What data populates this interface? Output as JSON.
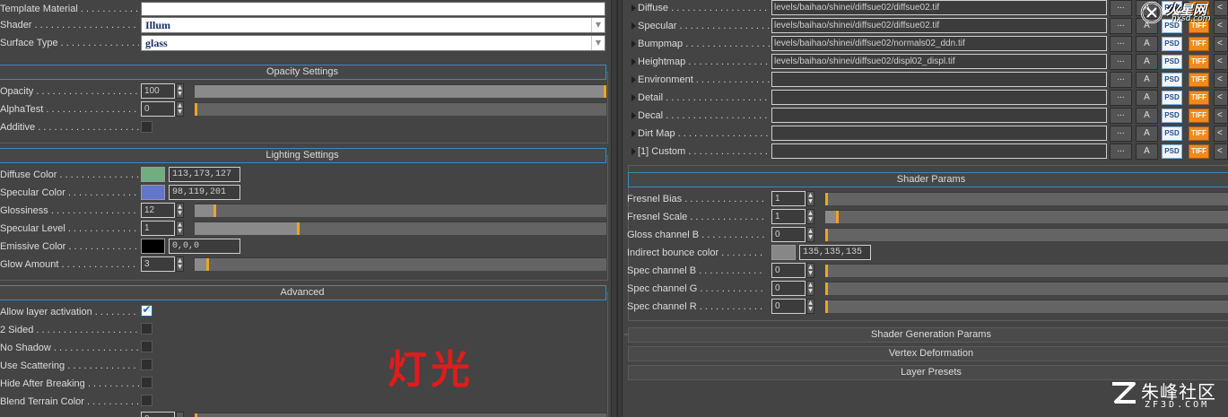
{
  "left": {
    "template_material": {
      "label": "Template Material . . . . . . . . . . . . .",
      "value": ""
    },
    "shader": {
      "label": "Shader . . . . . . . . . . . . . . . . . . . . .",
      "value": "Illum"
    },
    "surface_type": {
      "label": "Surface Type . . . . . . . . . . . . . . . .",
      "value": "glass"
    },
    "opacity_settings": {
      "header": "Opacity Settings",
      "opacity": {
        "label": "Opacity . . . . . . . . . . . . . . . . . . . .",
        "value": "100",
        "level": 100
      },
      "alpha_test": {
        "label": "AlphaTest . . . . . . . . . . . . . . . . . .",
        "value": "0",
        "level": 0
      },
      "additive": {
        "label": "Additive . . . . . . . . . . . . . . . . . . .",
        "checked": false
      }
    },
    "lighting_settings": {
      "header": "Lighting Settings",
      "diffuse_color": {
        "label": "Diffuse Color . . . . . . . . . . . . . . .",
        "value": "113,173,127",
        "color": "#71ad7f"
      },
      "specular_color": {
        "label": "Specular Color . . . . . . . . . . . . . .",
        "value": "98,119,201",
        "color": "#6277c9"
      },
      "glossiness": {
        "label": "Glossiness . . . . . . . . . . . . . . . . .",
        "value": "12",
        "level": 4.7
      },
      "specular_level": {
        "label": "Specular Level . . . . . . . . . . . . . .",
        "value": "1",
        "level": 25
      },
      "emissive_color": {
        "label": "Emissive Color . . . . . . . . . . . . . .",
        "value": "0,0,0",
        "color": "#000000"
      },
      "glow_amount": {
        "label": "Glow Amount . . . . . . . . . . . . . . . .",
        "value": "3",
        "level": 3
      }
    },
    "advanced": {
      "header": "Advanced",
      "items": [
        {
          "label": "Allow layer activation . . . . . . . .",
          "checked": true
        },
        {
          "label": "2 Sided . . . . . . . . . . . . . . . . . . .",
          "checked": false
        },
        {
          "label": "No Shadow . . . . . . . . . . . . . . . . .",
          "checked": false
        },
        {
          "label": "Use Scattering . . . . . . . . . . . . . . .",
          "checked": false
        },
        {
          "label": "Hide After Breaking . . . . . . . . . .",
          "checked": false
        },
        {
          "label": "Blend Terrain Color . . . . . . . . . .",
          "checked": false
        }
      ],
      "partial_spinner_value": "0"
    },
    "watermark": "灯光"
  },
  "right": {
    "textures": [
      {
        "label": "Diffuse . . . . . . . . . . . . . . . . . .",
        "path": "levels/baihao/shinei/diffsue02/diffsue02.tif"
      },
      {
        "label": "Specular . . . . . . . . . . . . . . . . .",
        "path": "levels/baihao/shinei/diffsue02/diffsue02.tif"
      },
      {
        "label": "Bumpmap . . . . . . . . . . . . . . . . .",
        "path": "levels/baihao/shinei/diffsue02/normals02_ddn.tif"
      },
      {
        "label": "Heightmap . . . . . . . . . . . . . . . .",
        "path": "levels/baihao/shinei/diffsue02/displ02_displ.tif"
      },
      {
        "label": "Environment . . . . . . . . . . . . . . .",
        "path": ""
      },
      {
        "label": "Detail . . . . . . . . . . . . . . . . . . .",
        "path": ""
      },
      {
        "label": "Decal . . . . . . . . . . . . . . . . . . . .",
        "path": ""
      },
      {
        "label": "Dirt Map . . . . . . . . . . . . . . . . . .",
        "path": ""
      },
      {
        "label": "[1] Custom . . . . . . . . . . . . . . . .",
        "path": ""
      }
    ],
    "texture_buttons": {
      "browse": "...",
      "a": "A",
      "psd": "PSD",
      "tiff": "TIFF",
      "more": "<"
    },
    "shader_params": {
      "header": "Shader Params",
      "fresnel_bias": {
        "label": "Fresnel Bias . . . . . . . . . . . . . . .",
        "value": "1",
        "level": 0
      },
      "fresnel_scale": {
        "label": "Fresnel Scale . . . . . . . . . . . . . .",
        "value": "1",
        "level": 3
      },
      "gloss_channel_b": {
        "label": "Gloss channel B . . . . . . . . . . . .",
        "value": "0",
        "level": 0
      },
      "indirect_bounce_color": {
        "label": "Indirect bounce color . . . . . . . .",
        "value": "135,135,135",
        "color": "#878787"
      },
      "spec_channel_b": {
        "label": "Spec channel B . . . . . . . . . . . .",
        "value": "0",
        "level": 0
      },
      "spec_channel_g": {
        "label": "Spec channel G . . . . . . . . . . . .",
        "value": "0",
        "level": 0
      },
      "spec_channel_r": {
        "label": "Spec channel R . . . . . . . . . . . .",
        "value": "0",
        "level": 0
      }
    },
    "collapsed_sections": [
      "Shader Generation Params",
      "Vertex Deformation",
      "Layer Presets"
    ],
    "watermark_top": {
      "title": "火星网",
      "url": "hxsd.com"
    },
    "watermark_bottom": {
      "title": "朱峰社区",
      "url": "ZF3D.COM"
    }
  },
  "colors": {
    "panel_bg": "#444444",
    "section_border": "#3a8bbf",
    "slider_thumb": "#f0a420",
    "checkbox_accent": "#1b6aa5",
    "watermark_red": "#e11b1b"
  }
}
